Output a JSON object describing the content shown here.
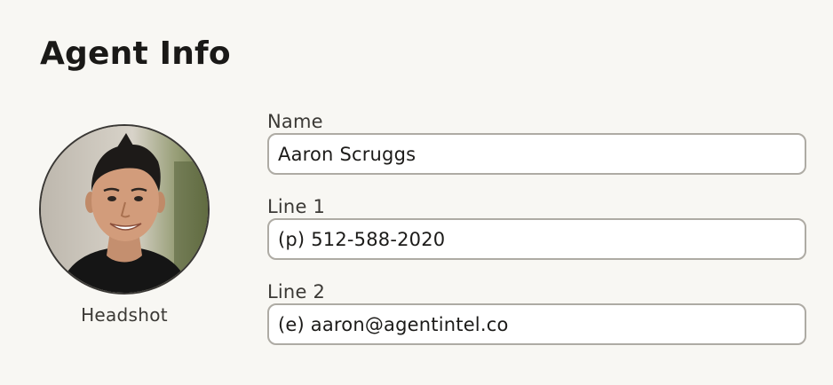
{
  "page": {
    "title": "Agent Info"
  },
  "headshot": {
    "label": "Headshot",
    "icon": "headshot-photo"
  },
  "fields": {
    "name": {
      "label": "Name",
      "value": "Aaron Scruggs"
    },
    "line1": {
      "label": "Line 1",
      "value": "(p) 512-588-2020"
    },
    "line2": {
      "label": "Line 2",
      "value": "(e) aaron@agentintel.co"
    }
  },
  "colors": {
    "background": "#f8f7f3",
    "input_border": "#aeaba4",
    "input_background": "#ffffff",
    "text": "#1c1b19"
  }
}
